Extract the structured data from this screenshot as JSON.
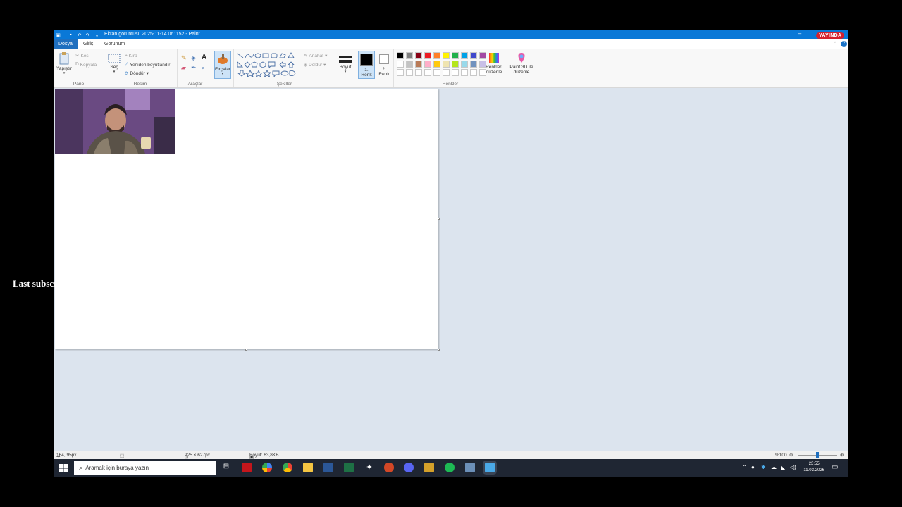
{
  "window": {
    "title": "Ekran görüntüsü 2025-11-14 061152 - Paint",
    "live_badge": "YAYINDA"
  },
  "menu": {
    "tabs": [
      "Dosya",
      "Giriş",
      "Görünüm"
    ],
    "help": "?"
  },
  "ribbon": {
    "clipboard": {
      "paste": "Yapıştır",
      "cut": "Kes",
      "copy": "Kopyala",
      "label": "Pano"
    },
    "image": {
      "select": "Seç",
      "crop": "Kırp",
      "resize": "Yeniden boyutlandır",
      "rotate": "Döndür",
      "label": "Resim"
    },
    "tools": {
      "text": "A",
      "label": "Araçlar"
    },
    "brushes": {
      "label": "Fırçalar"
    },
    "shapes": {
      "outline": "Anahat",
      "fill": "Doldur",
      "label": "Şekiller"
    },
    "size": {
      "label": "Boyut"
    },
    "color1": {
      "label_line1": "1.",
      "label_line2": "Renk"
    },
    "color2": {
      "label_line1": "2.",
      "label_line2": "Renk"
    },
    "colors": {
      "label": "Renkler",
      "edit_line1": "Renkleri",
      "edit_line2": "düzenle",
      "row1": [
        "#000000",
        "#7f7f7f",
        "#880015",
        "#ed1c24",
        "#ff7f27",
        "#fff200",
        "#22b14c",
        "#00a2e8",
        "#3f48cc",
        "#a349a4"
      ],
      "row2": [
        "#ffffff",
        "#c3c3c3",
        "#b97a57",
        "#ffaec9",
        "#ffc90e",
        "#efe4b0",
        "#b5e61d",
        "#99d9ea",
        "#7092be",
        "#c8bfe7"
      ],
      "row3": [
        "#ffffff",
        "#ffffff",
        "#ffffff",
        "#ffffff",
        "#ffffff",
        "#ffffff",
        "#ffffff",
        "#ffffff",
        "#ffffff",
        "#ffffff"
      ]
    },
    "paint3d": {
      "line1": "Paint 3D ile",
      "line2": "düzenle"
    }
  },
  "status": {
    "cursor": "164, 95px",
    "canvas_size": "925 × 627px",
    "file_size": "Boyut: 63,8KB",
    "zoom": "%100"
  },
  "taskbar": {
    "search_placeholder": "Aramak için buraya yazın",
    "time": "23:55",
    "date": "11.03.2026"
  },
  "overlay": {
    "text": "Last subscriber: gntsao"
  }
}
